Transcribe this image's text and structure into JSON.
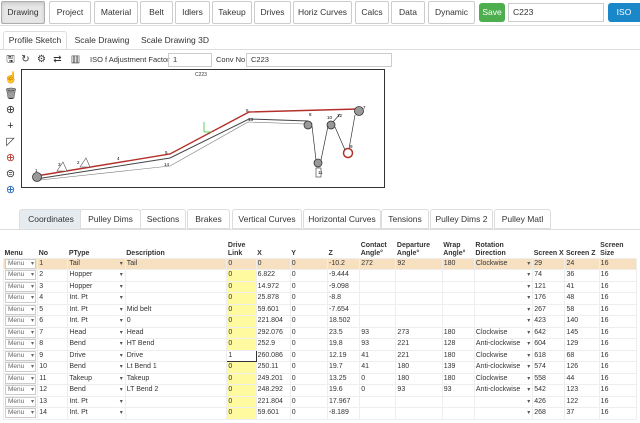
{
  "top_tabs": [
    "Drawing",
    "Project",
    "Material",
    "Belt",
    "Idlers",
    "Takeup",
    "Drives",
    "Horiz Curves",
    "Calcs",
    "Data",
    "Dynamic"
  ],
  "save_label": "Save",
  "drawing_name": "C223",
  "iso_label": "ISO",
  "sub_tabs": [
    "Profile Sketch",
    "Scale Drawing",
    "Scale Drawing 3D"
  ],
  "toolbar": {
    "adjust_label": "ISO f Adjustment Factor",
    "adjust_value": "1",
    "conv_label": "Conv No",
    "conv_value": "C223"
  },
  "drawing": {
    "title": "C223",
    "node_labels": [
      "1",
      "3",
      "2",
      "4",
      "5",
      "6",
      "7",
      "8",
      "9",
      "10",
      "11",
      "12",
      "13",
      "14"
    ],
    "accent": "#b5302a"
  },
  "data_tabs": [
    "Coordinates",
    "Pulley Dims",
    "Sections",
    "Brakes",
    "Vertical Curves",
    "Horizontal Curves",
    "Tensions",
    "Pulley Dims 2",
    "Pulley Matl"
  ],
  "table": {
    "headers": [
      "Menu",
      "No",
      "PType",
      "Description",
      "Drive Link",
      "X",
      "Y",
      "Z",
      "Contact Angle°",
      "Departure Angle°",
      "Wrap Angle°",
      "Rotation Direction",
      "Screen X",
      "Screen Z",
      "Screen Size"
    ],
    "menu_label": "Menu",
    "rows": [
      [
        "1",
        "Tail",
        "Tail",
        "0",
        "0",
        "0",
        "-10.2",
        "272",
        "92",
        "180",
        "Clockwise",
        "29",
        "24",
        "16"
      ],
      [
        "2",
        "Hopper",
        "",
        "0",
        "6.822",
        "0",
        "-9.444",
        "",
        "",
        "",
        "",
        "74",
        "36",
        "16"
      ],
      [
        "3",
        "Hopper",
        "",
        "0",
        "14.972",
        "0",
        "-9.098",
        "",
        "",
        "",
        "",
        "121",
        "41",
        "16"
      ],
      [
        "4",
        "Int. Pt",
        "",
        "0",
        "25.878",
        "0",
        "-8.8",
        "",
        "",
        "",
        "",
        "176",
        "48",
        "16"
      ],
      [
        "5",
        "Int. Pt",
        "Mid belt",
        "0",
        "59.601",
        "0",
        "-7.654",
        "",
        "",
        "",
        "",
        "267",
        "58",
        "16"
      ],
      [
        "6",
        "Int. Pt",
        "0",
        "0",
        "221.804",
        "0",
        "18.502",
        "",
        "",
        "",
        "",
        "423",
        "140",
        "16"
      ],
      [
        "7",
        "Head",
        "Head",
        "0",
        "292.076",
        "0",
        "23.5",
        "93",
        "273",
        "180",
        "Clockwise",
        "642",
        "145",
        "16"
      ],
      [
        "8",
        "Bend",
        "HT Bend",
        "0",
        "252.9",
        "0",
        "19.8",
        "93",
        "221",
        "128",
        "Anti-clockwise",
        "604",
        "129",
        "16"
      ],
      [
        "9",
        "Drive",
        "Drive",
        "1",
        "260.086",
        "0",
        "12.19",
        "41",
        "221",
        "180",
        "Clockwise",
        "618",
        "68",
        "16"
      ],
      [
        "10",
        "Bend",
        "Lt Bend 1",
        "0",
        "250.11",
        "0",
        "19.7",
        "41",
        "180",
        "139",
        "Anti-clockwise",
        "574",
        "126",
        "16"
      ],
      [
        "11",
        "Takeup",
        "Takeup",
        "0",
        "249.201",
        "0",
        "13.25",
        "0",
        "180",
        "180",
        "Clockwise",
        "558",
        "44",
        "16"
      ],
      [
        "12",
        "Bend",
        "LT Bend 2",
        "0",
        "248.292",
        "0",
        "19.6",
        "0",
        "93",
        "93",
        "Anti-clockwise",
        "542",
        "123",
        "16"
      ],
      [
        "13",
        "Int. Pt",
        "",
        "0",
        "221.804",
        "0",
        "17.967",
        "",
        "",
        "",
        "",
        "426",
        "122",
        "16"
      ],
      [
        "14",
        "Int. Pt",
        "",
        "0",
        "59.601",
        "0",
        "-8.189",
        "",
        "",
        "",
        "",
        "268",
        "37",
        "16"
      ]
    ]
  }
}
